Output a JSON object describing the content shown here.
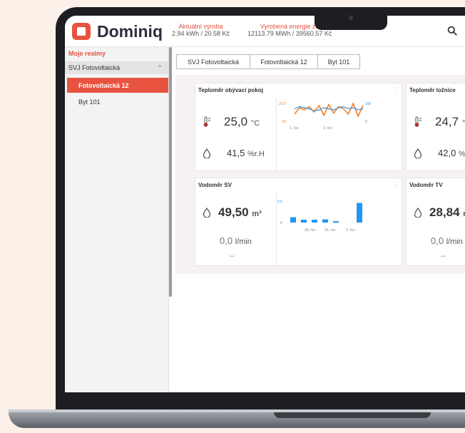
{
  "app": {
    "name": "Dominiq"
  },
  "header": {
    "stat1_label": "Aktuální výroba",
    "stat1_value": "2.94 kWh / 20.58 Kč",
    "stat2_label": "Vyrobená energie za",
    "stat2_value": "12113.79 MWh / 39560.57 Kč"
  },
  "sidebar": {
    "title": "Moje realmy",
    "group": "SVJ Fotovoltaická",
    "items": [
      {
        "label": "Fotovoltaická 12",
        "active": true
      },
      {
        "label": "Byt 101",
        "active": false
      }
    ]
  },
  "breadcrumb": [
    "SVJ Fotovoltaická",
    "Fotovoltaická 12",
    "Byt 101"
  ],
  "cards": {
    "thermo1": {
      "title": "Teploměr obývací pokoj",
      "temp": "25,0",
      "temp_unit": "°C",
      "hum": "41,5",
      "hum_unit": "%r.H"
    },
    "thermo2": {
      "title": "Teploměr ložnice",
      "temp": "24,7",
      "temp_unit": "°",
      "hum": "42,0",
      "hum_unit": "%"
    },
    "water1": {
      "title": "Vodoměr SV",
      "value": "49,50",
      "unit": "m³",
      "flow": "0,0",
      "flow_unit": "l/min",
      "extra": "--"
    },
    "water2": {
      "title": "Vodoměr TV",
      "value": "28,84",
      "unit": "m",
      "flow": "0,0",
      "flow_unit": "l/min",
      "extra": "--"
    }
  },
  "chart_data": [
    {
      "type": "line",
      "tick_labels_y_left": [
        "25.6",
        "24"
      ],
      "tick_labels_y_right": [
        "100",
        "0"
      ],
      "tick_labels_x": [
        "1. čvc",
        "3. čvc"
      ],
      "series": [
        {
          "color": "#f0822e",
          "values": [
            24.6,
            25.2,
            25.0,
            25.3,
            24.8,
            25.4,
            24.5,
            25.5,
            24.7,
            25.3,
            25.1,
            24.6,
            25.6,
            24.4,
            25.4
          ]
        },
        {
          "color": "#3a8fd8",
          "values": [
            25.1,
            25.3,
            25.2,
            25.1,
            24.9,
            25.0,
            25.2,
            25.1,
            25.0,
            25.2,
            25.3,
            25.1,
            25.2,
            25.0,
            25.1
          ]
        }
      ]
    },
    {
      "type": "bar",
      "tick_label_y_top": "0.6",
      "tick_label_y_bottom": "0",
      "tick_labels_x": [
        "28. čer",
        "30. čer",
        "2. čvc"
      ],
      "values": [
        0.15,
        0.08,
        0.08,
        0.09,
        0.04,
        0.55
      ],
      "ylim": [
        0,
        0.6
      ],
      "color": "#2196f3"
    }
  ]
}
